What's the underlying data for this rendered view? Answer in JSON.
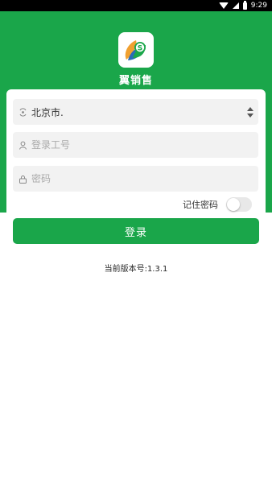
{
  "status_bar": {
    "time": "9:29"
  },
  "app": {
    "name": "翼销售"
  },
  "form": {
    "city": {
      "value": "北京市."
    },
    "username": {
      "placeholder": "登录工号"
    },
    "password": {
      "placeholder": "密码"
    },
    "remember_label": "记住密码",
    "remember_checked": false
  },
  "login_button": "登录",
  "version_text": "当前版本号:1.3.1",
  "colors": {
    "brand_green": "#1aa64a",
    "field_bg": "#f2f2f2"
  },
  "icons": [
    "wifi-icon",
    "signal-icon",
    "battery-icon",
    "location-icon",
    "user-icon",
    "lock-icon",
    "sort-arrows-icon"
  ]
}
